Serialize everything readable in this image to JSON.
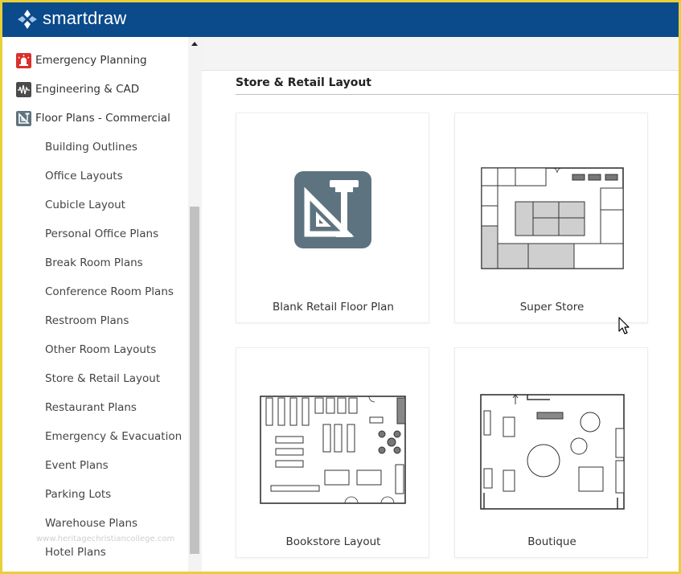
{
  "app": {
    "brand": "smartdraw"
  },
  "sidebar": {
    "categories": [
      {
        "label": "Emergency Planning",
        "icon": "emergency-planning-icon",
        "color": "#d9302c"
      },
      {
        "label": "Engineering & CAD",
        "icon": "engineering-cad-icon",
        "color": "#4a4a4a"
      },
      {
        "label": "Floor Plans - Commercial",
        "icon": "floor-plans-commercial-icon",
        "color": "#5e7380"
      }
    ],
    "subitems": [
      "Building Outlines",
      "Office Layouts",
      "Cubicle Layout",
      "Personal Office Plans",
      "Break Room Plans",
      "Conference Room Plans",
      "Restroom Plans",
      "Other Room Layouts",
      "Store & Retail Layout",
      "Restaurant Plans",
      "Emergency & Evacuation",
      "Event Plans",
      "Parking Lots",
      "Warehouse Plans",
      "Hotel Plans"
    ]
  },
  "main": {
    "section_title": "Store & Retail Layout",
    "templates": [
      {
        "label": "Blank Retail Floor Plan",
        "icon": "floor-plan-icon",
        "color": "#5e7380"
      },
      {
        "label": "Super Store",
        "icon": "super-store-plan-thumbnail"
      },
      {
        "label": "Bookstore Layout",
        "icon": "bookstore-plan-thumbnail"
      },
      {
        "label": "Boutique",
        "icon": "boutique-plan-thumbnail"
      }
    ]
  },
  "watermark": "www.heritagechristiancollege.com",
  "colors": {
    "topbar": "#0b4a8b",
    "frame": "#e8cf3a"
  }
}
